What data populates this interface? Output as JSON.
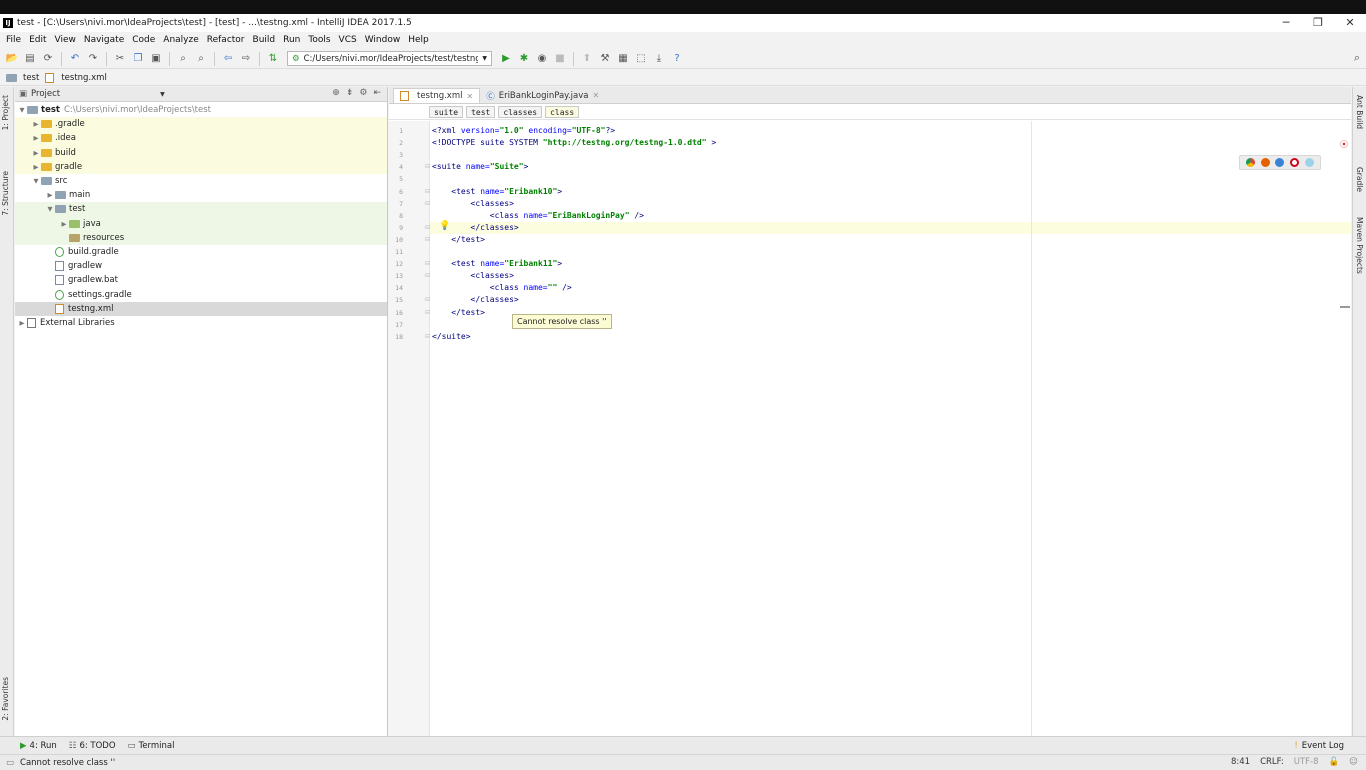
{
  "titlebar": {
    "title": "test - [C:\\Users\\nivi.mor\\IdeaProjects\\test] - [test] - ...\\testng.xml - IntelliJ IDEA 2017.1.5",
    "minimize": "─",
    "restore": "❐",
    "close": "✕"
  },
  "menu": [
    "File",
    "Edit",
    "View",
    "Navigate",
    "Code",
    "Analyze",
    "Refactor",
    "Build",
    "Run",
    "Tools",
    "VCS",
    "Window",
    "Help"
  ],
  "toolbar": {
    "run_config": "C:/Users/nivi.mor/IdeaProjects/test/testng.xml"
  },
  "navbar": {
    "project": "test",
    "file": "testng.xml"
  },
  "left_strip": {
    "project": "1: Project",
    "structure": "7: Structure",
    "favorites": "2: Favorites"
  },
  "right_strip": {
    "ant": "Ant Build",
    "gradle": "Gradle",
    "maven": "Maven Projects"
  },
  "project_panel": {
    "header": "Project",
    "tree": [
      {
        "label": "test",
        "note": "C:\\Users\\nivi.mor\\IdeaProjects\\test",
        "indent": 0,
        "arrow": "▼",
        "icon": "grey"
      },
      {
        "label": ".gradle",
        "indent": 1,
        "arrow": "▶",
        "icon": "folder"
      },
      {
        "label": ".idea",
        "indent": 1,
        "arrow": "▶",
        "icon": "folder"
      },
      {
        "label": "build",
        "indent": 1,
        "arrow": "▶",
        "icon": "folder"
      },
      {
        "label": "gradle",
        "indent": 1,
        "arrow": "▶",
        "icon": "folder"
      },
      {
        "label": "src",
        "indent": 1,
        "arrow": "▼",
        "icon": "grey"
      },
      {
        "label": "main",
        "indent": 2,
        "arrow": "▶",
        "icon": "grey"
      },
      {
        "label": "test",
        "indent": 2,
        "arrow": "▼",
        "icon": "grey"
      },
      {
        "label": "java",
        "indent": 3,
        "arrow": "▶",
        "icon": "green"
      },
      {
        "label": "resources",
        "indent": 3,
        "arrow": "",
        "icon": "res"
      },
      {
        "label": "build.gradle",
        "indent": 2,
        "arrow": "",
        "icon": "gradle"
      },
      {
        "label": "gradlew",
        "indent": 2,
        "arrow": "",
        "icon": "file"
      },
      {
        "label": "gradlew.bat",
        "indent": 2,
        "arrow": "",
        "icon": "file"
      },
      {
        "label": "settings.gradle",
        "indent": 2,
        "arrow": "",
        "icon": "gradle"
      },
      {
        "label": "testng.xml",
        "indent": 2,
        "arrow": "",
        "icon": "xml"
      },
      {
        "label": "External Libraries",
        "indent": 0,
        "arrow": "▶",
        "icon": "lib"
      }
    ]
  },
  "editor": {
    "tabs": [
      {
        "label": "testng.xml",
        "active": true
      },
      {
        "label": "EriBankLoginPay.java",
        "active": false
      }
    ],
    "breadcrumbs": [
      "suite",
      "test",
      "classes",
      "class"
    ],
    "lines": [
      {
        "n": "1",
        "html": "<span class='tag'>&lt;?xml</span> <span class='attr'>version=</span><span class='str'>\"1.0\"</span> <span class='attr'>encoding=</span><span class='str'>\"UTF-8\"</span><span class='tag'>?&gt;</span>"
      },
      {
        "n": "2",
        "html": "<span class='tag'>&lt;!DOCTYPE suite SYSTEM</span> <span class='str'>\"http://testng.org/testng-1.0.dtd\"</span> <span class='tag'>&gt;</span>"
      },
      {
        "n": "3",
        "html": ""
      },
      {
        "n": "4",
        "html": "<span class='tag'>&lt;suite</span> <span class='attr'>name=</span><span class='str'>\"Suite\"</span><span class='tag'>&gt;</span>"
      },
      {
        "n": "5",
        "html": ""
      },
      {
        "n": "6",
        "html": "    <span class='tag'>&lt;test</span> <span class='attr'>name=</span><span class='str'>\"Eribank10\"</span><span class='tag'>&gt;</span>"
      },
      {
        "n": "7",
        "html": "        <span class='tag'>&lt;classes&gt;</span>"
      },
      {
        "n": "8",
        "html": "            <span class='tag'>&lt;class</span> <span class='attr'>name=</span><span class='str'>\"EriBankLoginPay\"</span> <span class='tag'>/&gt;</span>"
      },
      {
        "n": "9",
        "html": "        <span class='tag'>&lt;/classes&gt;</span>"
      },
      {
        "n": "10",
        "html": "    <span class='tag'>&lt;/test&gt;</span>"
      },
      {
        "n": "11",
        "html": ""
      },
      {
        "n": "12",
        "html": "    <span class='tag'>&lt;test</span> <span class='attr'>name=</span><span class='str'>\"Eribank11\"</span><span class='tag'>&gt;</span>"
      },
      {
        "n": "13",
        "html": "        <span class='tag'>&lt;classes&gt;</span>"
      },
      {
        "n": "14",
        "html": "            <span class='tag'>&lt;class</span> <span class='attr'>name=</span><span class='str'>\"\"</span> <span class='tag'>/&gt;</span>"
      },
      {
        "n": "15",
        "html": "        <span class='tag'>&lt;/classes&gt;</span>"
      },
      {
        "n": "16",
        "html": "    <span class='tag'>&lt;/test&gt;</span>"
      },
      {
        "n": "17",
        "html": ""
      },
      {
        "n": "18",
        "html": "<span class='tag'>&lt;/suite&gt;</span>"
      }
    ],
    "tooltip": "Cannot resolve class ''"
  },
  "bottom_tools": [
    {
      "label": "4: Run",
      "icon": "run-icon"
    },
    {
      "label": "6: TODO",
      "icon": "todo-icon"
    },
    {
      "label": "Terminal",
      "icon": "terminal-icon"
    }
  ],
  "event_log": "Event Log",
  "status": {
    "message": "Cannot resolve class ''",
    "position": "8:41",
    "line_sep": "CRLF:",
    "encoding": "UTF-8"
  },
  "colors": {
    "accent": "#3a78c9",
    "run_green": "#2e9a2e",
    "error": "#d33333"
  }
}
